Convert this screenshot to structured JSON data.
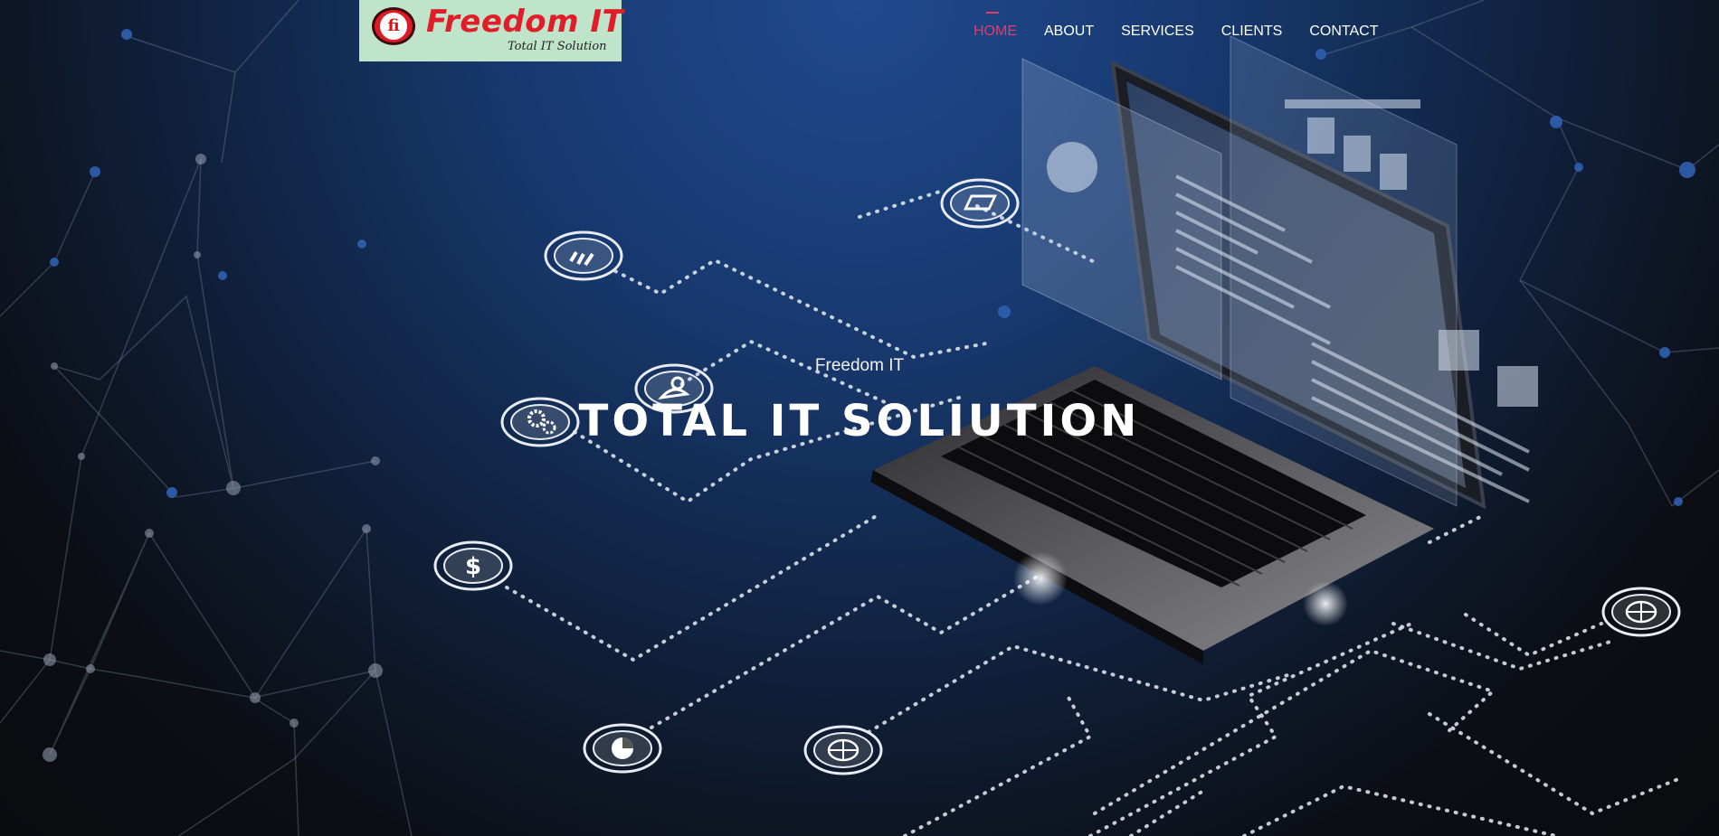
{
  "brand": {
    "logo_mark": "fi",
    "name": "Freedom IT",
    "tagline": "Total IT Solution",
    "colors": {
      "logo_bg": "#bfe4c9",
      "logo_red": "#e11d2a"
    }
  },
  "nav": {
    "items": [
      {
        "label": "HOME",
        "active": true
      },
      {
        "label": "ABOUT",
        "active": false
      },
      {
        "label": "SERVICES",
        "active": false
      },
      {
        "label": "CLIENTS",
        "active": false
      },
      {
        "label": "CONTACT",
        "active": false
      }
    ],
    "active_color": "#e8396b"
  },
  "hero": {
    "subtitle": "Freedom IT",
    "title": "TOTAL IT SOLIUTION",
    "icons": [
      "bar-chart-icon",
      "settings-gears-icon",
      "user-icon",
      "dollar-icon",
      "pie-chart-icon",
      "globe-icon",
      "monitor-icon",
      "laptop-icon"
    ]
  }
}
